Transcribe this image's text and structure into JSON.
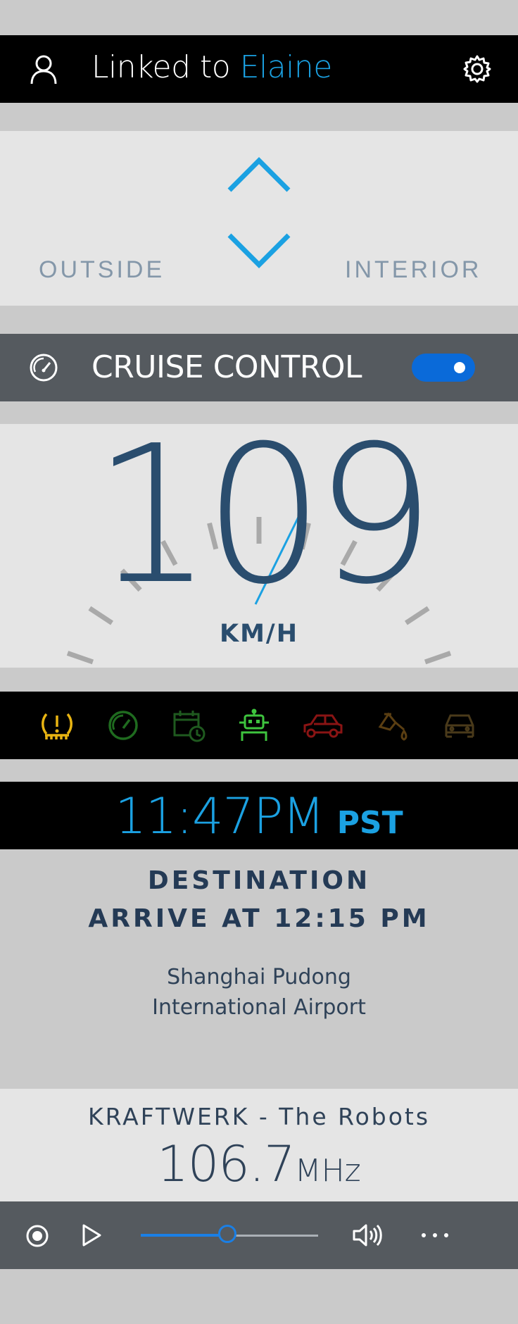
{
  "header": {
    "linked_prefix": "Linked to ",
    "linked_name": "Elaine",
    "user_icon": "user-icon",
    "settings_icon": "gear-icon"
  },
  "climate": {
    "left_label": "OUTSIDE",
    "right_label": "INTERIOR",
    "up_icon": "chevron-up-icon",
    "down_icon": "chevron-down-icon"
  },
  "cruise": {
    "label": "CRUISE CONTROL",
    "enabled": true,
    "icon": "gauge-icon"
  },
  "speedometer": {
    "value": "109",
    "unit": "KM/H"
  },
  "status_icons": [
    {
      "name": "tire-pressure-warning-icon",
      "color": "#e8b412"
    },
    {
      "name": "speedometer-icon",
      "color": "#1f6b1f"
    },
    {
      "name": "calendar-clock-icon",
      "color": "#1f5a1f"
    },
    {
      "name": "robot-icon",
      "color": "#3ec43e"
    },
    {
      "name": "car-side-icon",
      "color": "#8a1414"
    },
    {
      "name": "oil-can-icon",
      "color": "#5a3e12"
    },
    {
      "name": "car-front-icon",
      "color": "#4a3a1a"
    }
  ],
  "clock": {
    "time": "11:47PM",
    "zone": "PST"
  },
  "destination": {
    "title": "DESTINATION",
    "arrival": "ARRIVE AT 12:15 PM",
    "place_line1": "Shanghai Pudong",
    "place_line2": "International Airport"
  },
  "radio": {
    "track": "KRAFTWERK - The Robots",
    "frequency": "106.7",
    "unit": "MHz"
  },
  "player": {
    "progress": 0.5,
    "record_icon": "record-icon",
    "play_icon": "play-icon",
    "volume_icon": "volume-icon",
    "more_icon": "more-icon"
  },
  "colors": {
    "accent": "#1ba1e2",
    "toggle": "#0a6ad9",
    "text_dark": "#2a4d6e"
  }
}
